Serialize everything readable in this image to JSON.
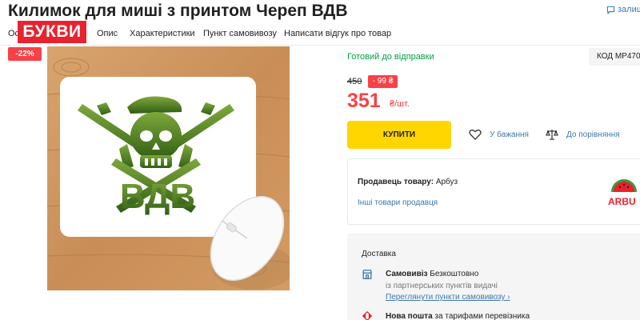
{
  "product": {
    "title": "Килимок для миші з принтом Череп ВДВ",
    "badge_discount": "-22%",
    "image_print_text": "ВДВ"
  },
  "header": {
    "feedback_label": "залиш"
  },
  "overlay": {
    "brand_label": "БУКВИ"
  },
  "tabs": [
    {
      "label": "Ос"
    },
    {
      "label": "Опис"
    },
    {
      "label": "Характеристики"
    },
    {
      "label": "Пункт самовивозу"
    },
    {
      "label": "Написати відгук про товар"
    }
  ],
  "availability": {
    "status": "Готовий до відправки",
    "code": "КОД MP470"
  },
  "pricing": {
    "old_price": "450",
    "price_drop": "- 99 ₴",
    "current_price": "351",
    "unit": "₴/шт."
  },
  "actions": {
    "buy_label": "КУПИТИ",
    "wishlist_label": "У бажання",
    "compare_label": "До порівняння"
  },
  "seller": {
    "label": "Продавець товару:",
    "name": "Арбуз",
    "other_goods_link": "Інші товари продавця",
    "logo_text": "ARBU"
  },
  "delivery": {
    "title": "Доставка",
    "pickup": {
      "name": "Самовивіз",
      "price": "Безкоштовно",
      "subtitle": "із партнерських пунктів видачі",
      "link": "Переглянути пункти самовивозу ›"
    },
    "nova_poshta": {
      "name": "Нова пошта",
      "price": "за тарифами перевізника"
    }
  },
  "colors": {
    "brand_red": "#f84147",
    "buy_yellow": "#ffd600",
    "link_blue": "#3e77aa",
    "ready_green": "#00a046",
    "overlay_red": "#e8222f",
    "print_green": "#4f7e24"
  }
}
